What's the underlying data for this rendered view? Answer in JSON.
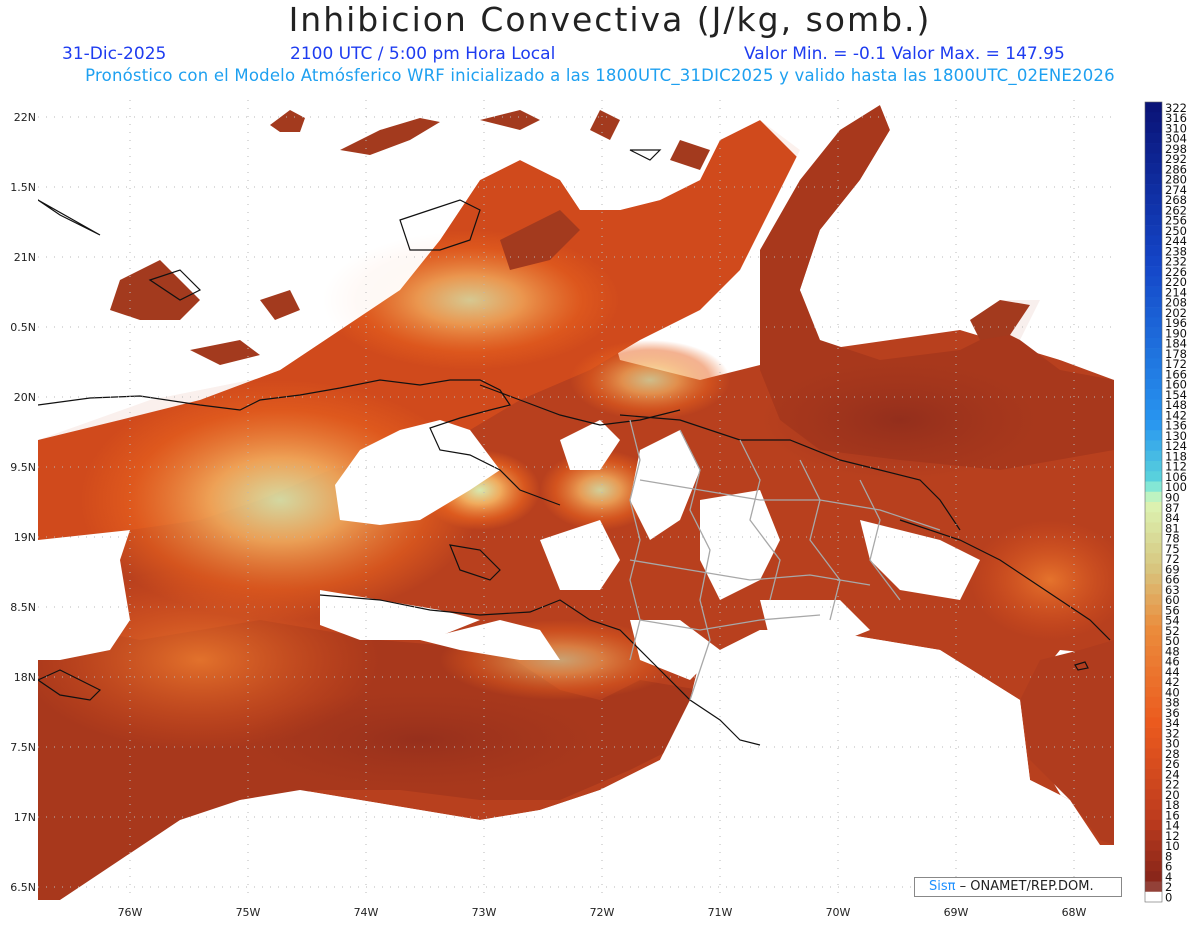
{
  "header": {
    "title": "Inhibicion Convectiva (J/kg, somb.)",
    "date": "31-Dic-2025",
    "valid_time": "2100 UTC / 5:00 pm Hora Local",
    "min_max": "Valor Min. = -0.1  Valor Max. = 147.95",
    "subtitle": "Pronóstico con el Modelo Atmósferico WRF inicializado a las 1800UTC_31DIC2025 y valido hasta las  1800UTC_02ENE2026"
  },
  "map": {
    "lat_labels": [
      "22N",
      "1.5N",
      "21N",
      "0.5N",
      "20N",
      "9.5N",
      "19N",
      "8.5N",
      "18N",
      "7.5N",
      "17N",
      "6.5N"
    ],
    "lon_labels": [
      "76W",
      "75W",
      "74W",
      "73W",
      "72W",
      "71W",
      "70W",
      "69W",
      "68W"
    ],
    "colors": {
      "low": "#8c2a1c",
      "mid": "#e8561c",
      "high": "#f6a04c",
      "peak": "#c8f0b0",
      "blank": "#ffffff",
      "coast": "#111111",
      "border": "#a8a8a8"
    }
  },
  "colorbar": {
    "labels": [
      "322",
      "316",
      "310",
      "304",
      "298",
      "292",
      "286",
      "280",
      "274",
      "268",
      "262",
      "256",
      "250",
      "244",
      "238",
      "232",
      "226",
      "220",
      "214",
      "208",
      "202",
      "196",
      "190",
      "184",
      "178",
      "172",
      "166",
      "160",
      "154",
      "148",
      "142",
      "136",
      "130",
      "124",
      "118",
      "112",
      "106",
      "100",
      "90",
      "87",
      "84",
      "81",
      "78",
      "75",
      "72",
      "69",
      "66",
      "63",
      "60",
      "56",
      "54",
      "52",
      "50",
      "48",
      "46",
      "44",
      "42",
      "40",
      "38",
      "36",
      "34",
      "32",
      "30",
      "28",
      "26",
      "24",
      "22",
      "20",
      "18",
      "16",
      "14",
      "12",
      "10",
      "8",
      "6",
      "4",
      "2",
      "0"
    ]
  },
  "credit": {
    "brand": "Sisπ",
    "text": "– ONAMET/REP.DOM."
  }
}
